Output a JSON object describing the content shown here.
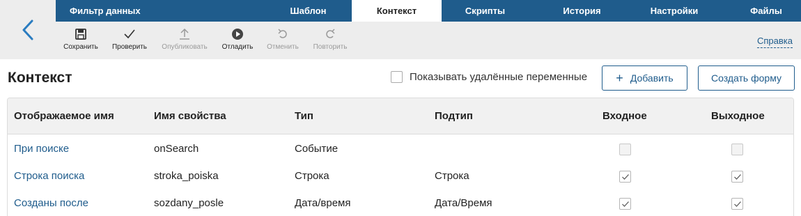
{
  "header": {
    "app_title": "Фильтр данных",
    "tabs": [
      {
        "label": "Шаблон"
      },
      {
        "label": "Контекст"
      },
      {
        "label": "Скрипты"
      },
      {
        "label": "История"
      },
      {
        "label": "Настройки"
      },
      {
        "label": "Файлы"
      }
    ],
    "active_tab": "Контекст"
  },
  "toolbar": {
    "save": "Сохранить",
    "check": "Проверить",
    "publish": "Опубликовать",
    "debug": "Отладить",
    "undo": "Отменить",
    "redo": "Повторить",
    "help": "Справка"
  },
  "main": {
    "title": "Контекст",
    "show_deleted_label": "Показывать удалённые переменные",
    "show_deleted_checked": false,
    "add_button": "Добавить",
    "create_form_button": "Создать форму"
  },
  "table": {
    "columns": [
      "Отображаемое имя",
      "Имя свойства",
      "Тип",
      "Подтип",
      "Входное",
      "Выходное"
    ],
    "rows": [
      {
        "display_name": "При поиске",
        "property": "onSearch",
        "type": "Событие",
        "subtype": "",
        "input": false,
        "output": false,
        "disabled": true
      },
      {
        "display_name": "Строка поиска",
        "property": "stroka_poiska",
        "type": "Строка",
        "subtype": "Строка",
        "input": true,
        "output": true,
        "disabled": false
      },
      {
        "display_name": "Созданы после",
        "property": "sozdany_posle",
        "type": "Дата/время",
        "subtype": "Дата/Время",
        "input": true,
        "output": true,
        "disabled": false
      }
    ]
  },
  "colors": {
    "brand": "#1f5c8c",
    "toolbar_bg": "#ededed",
    "header_bg": "#f1f1f1"
  }
}
